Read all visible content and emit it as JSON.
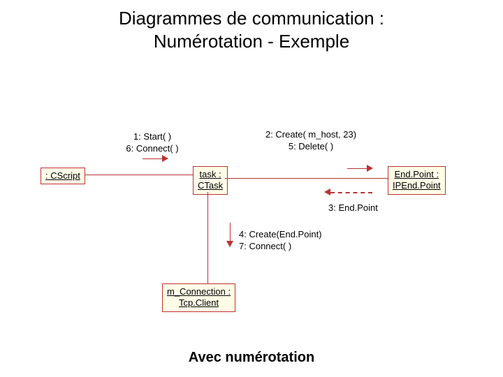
{
  "title_line1": "Diagrammes de communication :",
  "title_line2": "Numérotation - Exemple",
  "caption": "Avec numérotation",
  "nodes": {
    "cscript": ": CScript",
    "task_top": "task :",
    "task_bot": "CTask",
    "endpoint_top": "End.Point :",
    "endpoint_bot": "IPEnd.Point",
    "conn_top": "m_Connection :",
    "conn_bot": "Tcp.Client"
  },
  "messages": {
    "m1": "1: Start( )",
    "m6": "6: Connect( )",
    "m2": "2: Create( m_host, 23)",
    "m5": "5: Delete( )",
    "m3": "3: End.Point",
    "m4": "4: Create(End.Point)",
    "m7": "7: Connect( )"
  }
}
